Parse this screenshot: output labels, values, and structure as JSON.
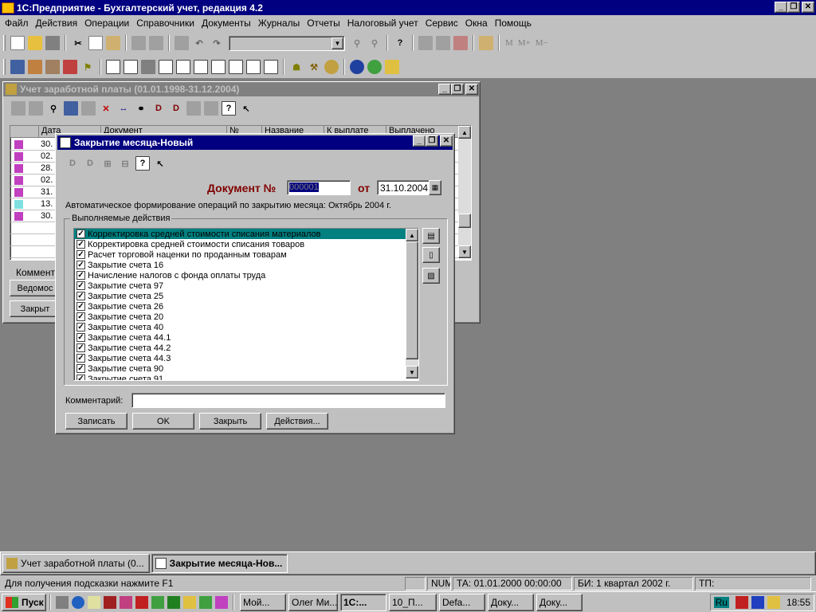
{
  "app": {
    "title": "1С:Предприятие - Бухгалтерский учет, редакция 4.2",
    "caption_buttons": [
      "_",
      "❐",
      "✕"
    ]
  },
  "menu": [
    "Файл",
    "Действия",
    "Операции",
    "Справочники",
    "Документы",
    "Журналы",
    "Отчеты",
    "Налоговый учет",
    "Сервис",
    "Окна",
    "Помощь"
  ],
  "toolbar1": {
    "m_labels": [
      "M",
      "M+",
      "M−"
    ]
  },
  "back_window": {
    "title": "Учет заработной платы (01.01.1998-31.12.2004)",
    "columns": [
      "Дата",
      "Документ",
      "№",
      "Название",
      "К выплате",
      "Выплачено"
    ],
    "rows": [
      "30.",
      "02.",
      "28.",
      "02.",
      "31.",
      "13.",
      "30."
    ],
    "comment_label": "Коммент",
    "btn1": "Ведомос",
    "btn2": "Закрыт"
  },
  "dialog": {
    "title": "Закрытие месяца-Новый",
    "doc_label": "Документ №",
    "doc_number": "000001",
    "from_label": "от",
    "date": "31.10.2004",
    "description": "Автоматическое формирование операций по закрытию месяца: Октябрь 2004 г.",
    "group_label": "Выполняемые действия",
    "actions": [
      "Корректировка средней стоимости списания материалов",
      "Корректировка средней стоимости списания товаров",
      "Расчет торговой наценки по проданным товарам",
      "Закрытие счета 16",
      "Начисление налогов с фонда оплаты труда",
      "Закрытие счета 97",
      "Закрытие счета 25",
      "Закрытие счета 26",
      "Закрытие счета 20",
      "Закрытие счета 40",
      "Закрытие счета 44.1",
      "Закрытие счета 44.2",
      "Закрытие счета 44.3",
      "Закрытие счета 90",
      "Закрытие счета 91"
    ],
    "comment_label": "Комментарий:",
    "buttons": {
      "save": "Записать",
      "ok": "OK",
      "close": "Закрыть",
      "actions": "Действия..."
    }
  },
  "mdi_tabs": [
    "Учет заработной платы (0...",
    "Закрытие месяца-Нов..."
  ],
  "status": {
    "hint": "Для получения подсказки нажмите F1",
    "num": "NUM",
    "ta": "ТА: 01.01.2000  00:00:00",
    "bi": "БИ: 1 квартал 2002 г.",
    "tp": "ТП:"
  },
  "taskbar": {
    "start": "Пуск",
    "tasks": [
      "Мой...",
      "Олег Ми...",
      "1С:...",
      "10_П...",
      "Defa...",
      "Доку...",
      "Доку..."
    ],
    "lang": "Ru",
    "clock": "18:55"
  }
}
